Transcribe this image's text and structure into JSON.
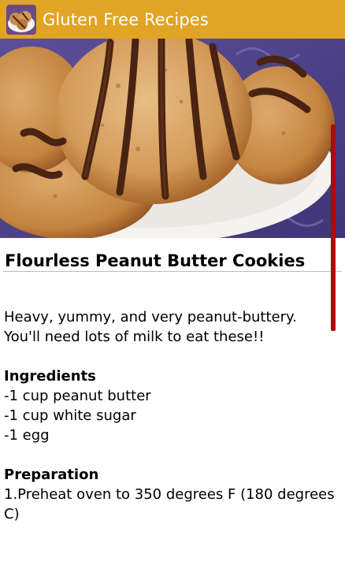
{
  "action_bar": {
    "title": "Gluten Free Recipes",
    "icon": "cookie-plate-icon",
    "background": "#e1a424"
  },
  "recipe": {
    "title": "Flourless Peanut Butter Cookies",
    "description": "Heavy, yummy, and very peanut-buttery. You'll need lots of milk to eat these!!",
    "ingredients_heading": "Ingredients",
    "ingredients": [
      "-1 cup peanut butter",
      "-1 cup white sugar",
      "-1 egg"
    ],
    "preparation_heading": "Preparation",
    "preparation": [
      "1.Preheat oven to 350 degrees F (180 degrees C)"
    ]
  },
  "colors": {
    "scrollbar": "#a30f0f",
    "divider": "#bdbdbd"
  }
}
